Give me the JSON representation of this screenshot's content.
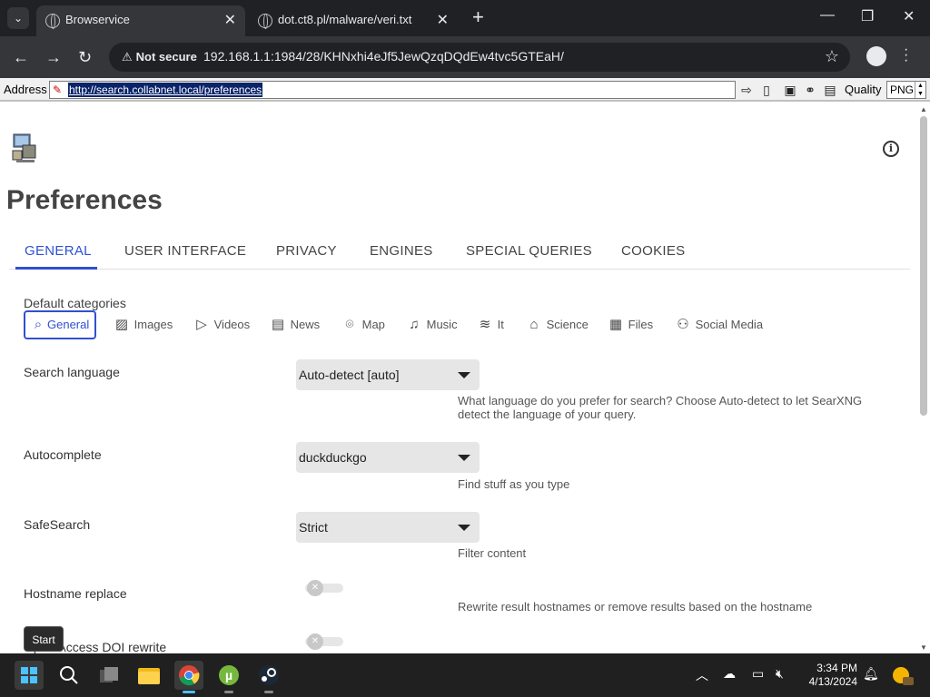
{
  "browser": {
    "tabs": [
      {
        "title": "Browservice",
        "active": true
      },
      {
        "title": "dot.ct8.pl/malware/veri.txt",
        "active": false
      }
    ],
    "security_label": "Not secure",
    "url": "192.168.1.1:1984/28/KHNxhi4eJf5JewQzqDQdEw4tvc5GTEaH/"
  },
  "legacy_bar": {
    "address_label": "Address",
    "address_value": "http://search.collabnet.local/preferences",
    "quality_label": "Quality",
    "quality_value": "PNG"
  },
  "page": {
    "title": "Preferences",
    "tabs": [
      "GENERAL",
      "USER INTERFACE",
      "PRIVACY",
      "ENGINES",
      "SPECIAL QUERIES",
      "COOKIES"
    ],
    "active_tab": "GENERAL",
    "default_categories_label": "Default categories",
    "categories": [
      {
        "label": "General",
        "icon": "search-icon",
        "selected": true
      },
      {
        "label": "Images",
        "icon": "image-icon",
        "selected": false
      },
      {
        "label": "Videos",
        "icon": "play-icon",
        "selected": false
      },
      {
        "label": "News",
        "icon": "newspaper-icon",
        "selected": false
      },
      {
        "label": "Map",
        "icon": "map-pin-icon",
        "selected": false
      },
      {
        "label": "Music",
        "icon": "music-icon",
        "selected": false
      },
      {
        "label": "It",
        "icon": "layers-icon",
        "selected": false
      },
      {
        "label": "Science",
        "icon": "school-icon",
        "selected": false
      },
      {
        "label": "Files",
        "icon": "archive-icon",
        "selected": false
      },
      {
        "label": "Social Media",
        "icon": "people-icon",
        "selected": false
      }
    ],
    "settings": {
      "search_language": {
        "label": "Search language",
        "value": "Auto-detect [auto]",
        "help": "What language do you prefer for search? Choose Auto-detect to let SearXNG detect the language of your query."
      },
      "autocomplete": {
        "label": "Autocomplete",
        "value": "duckduckgo",
        "help": "Find stuff as you type"
      },
      "safesearch": {
        "label": "SafeSearch",
        "value": "Strict",
        "help": "Filter content"
      },
      "hostname_replace": {
        "label": "Hostname replace",
        "enabled": false,
        "help": "Rewrite result hostnames or remove results based on the hostname"
      },
      "open_access_doi": {
        "label": "Open Access DOI rewrite",
        "enabled": false
      }
    }
  },
  "tooltip": "Start",
  "taskbar": {
    "apps": [
      "start",
      "search",
      "task-view",
      "file-explorer",
      "chrome",
      "utorrent",
      "steam"
    ],
    "time": "3:34 PM",
    "date": "4/13/2024"
  },
  "colors": {
    "accent": "#3050d0",
    "chrome_dark": "#202124",
    "chrome_mid": "#35363a"
  }
}
